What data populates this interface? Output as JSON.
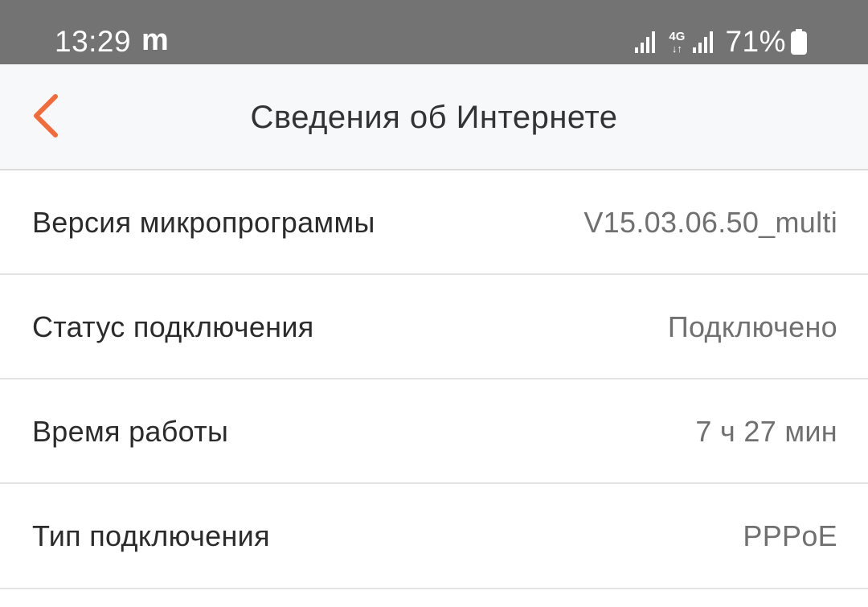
{
  "status_bar": {
    "time": "13:29",
    "app_indicator": "m",
    "network_type": "4G",
    "network_arrows": "↓↑",
    "battery_percent": "71%",
    "icons": [
      "signal-icon",
      "network-4g-icon",
      "signal-icon",
      "battery-icon"
    ]
  },
  "header": {
    "title": "Сведения об Интернете",
    "back_icon": "chevron-left-icon",
    "accent_color": "#f26b3a"
  },
  "info_rows": [
    {
      "label": "Версия микропрограммы",
      "value": "V15.03.06.50_multi"
    },
    {
      "label": "Статус подключения",
      "value": "Подключено"
    },
    {
      "label": "Время работы",
      "value": "7 ч 27 мин"
    },
    {
      "label": "Тип подключения",
      "value": "PPPoE"
    }
  ]
}
